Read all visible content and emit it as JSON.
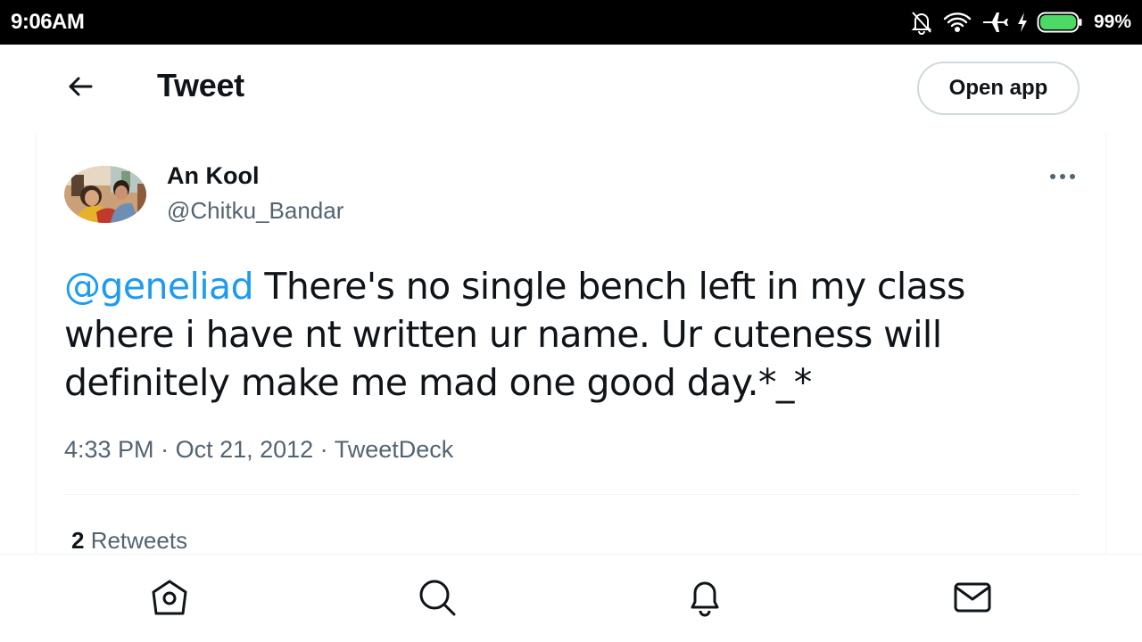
{
  "status_bar": {
    "time": "9:06AM",
    "battery_percent": "99%",
    "icons": [
      "notifications-off-icon",
      "wifi-icon",
      "airplane-mode-icon",
      "charging-icon",
      "battery-icon"
    ]
  },
  "header": {
    "back_icon": "arrow-left-icon",
    "title": "Tweet",
    "open_app_label": "Open app"
  },
  "tweet": {
    "author_name": "An Kool",
    "author_handle": "@Chitku_Bandar",
    "more_icon": "more-horizontal-icon",
    "mention": "@geneliad",
    "text": " There's no single bench left in my class where i have nt written ur name. Ur cuteness will definitely make me mad one good day.*_*",
    "time": "4:33 PM",
    "separator": " · ",
    "date": "Oct 21, 2012",
    "source": "TweetDeck",
    "retweet_count": "2",
    "retweet_label": " Retweets"
  },
  "bottom_nav": {
    "items": [
      "home-icon",
      "search-icon",
      "notifications-bell-icon",
      "messages-envelope-icon"
    ]
  },
  "colors": {
    "accent": "#1d9bf0",
    "text_primary": "#0f1419",
    "text_secondary": "#536471",
    "border": "#eff3f4"
  }
}
